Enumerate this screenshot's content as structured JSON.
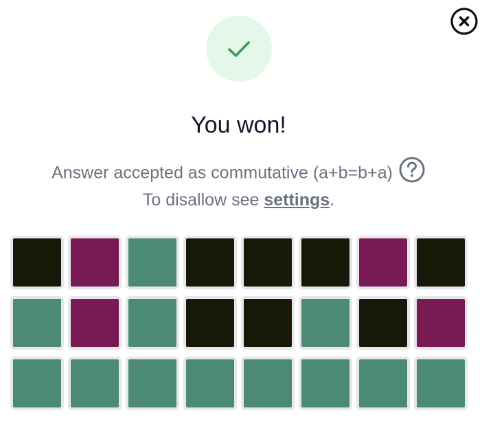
{
  "dialog": {
    "title": "You won!",
    "message_line1": "Answer accepted as commutative (a+b=b+a)",
    "message_line2_prefix": "To disallow see ",
    "settings_link": "settings",
    "message_line2_suffix": ".",
    "icons": {
      "close": "close-icon",
      "success": "check-icon",
      "help": "help-icon"
    }
  },
  "colors": {
    "correct": "#4c8a76",
    "misplaced": "#7a1a54",
    "absent": "#181808",
    "cell_border": "#e5e7eb",
    "success_bg": "#e3f8e8",
    "success_check": "#3a9a4e"
  },
  "board": {
    "rows": [
      [
        "absent",
        "misplaced",
        "correct",
        "absent",
        "absent",
        "absent",
        "misplaced",
        "absent"
      ],
      [
        "correct",
        "misplaced",
        "correct",
        "absent",
        "absent",
        "correct",
        "absent",
        "misplaced"
      ],
      [
        "correct",
        "correct",
        "correct",
        "correct",
        "correct",
        "correct",
        "correct",
        "correct"
      ]
    ]
  }
}
